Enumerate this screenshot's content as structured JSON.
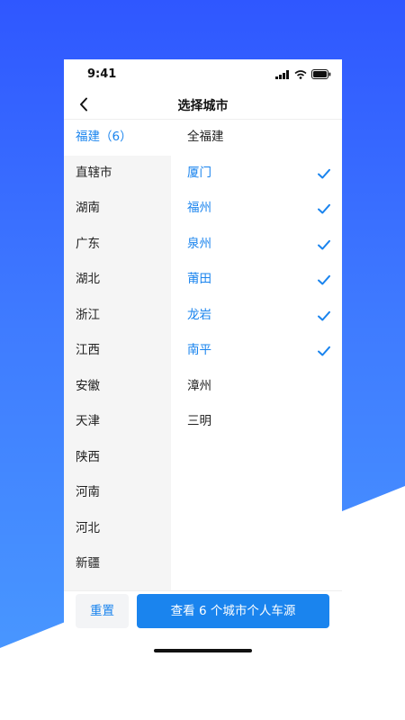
{
  "status_bar": {
    "time": "9:41"
  },
  "nav": {
    "title": "选择城市"
  },
  "provinces": [
    {
      "label": "福建（6）",
      "active": true
    },
    {
      "label": "直辖市"
    },
    {
      "label": "湖南"
    },
    {
      "label": "广东"
    },
    {
      "label": "湖北"
    },
    {
      "label": "浙江"
    },
    {
      "label": "江西"
    },
    {
      "label": "安徽"
    },
    {
      "label": "天津"
    },
    {
      "label": "陕西"
    },
    {
      "label": "河南"
    },
    {
      "label": "河北"
    },
    {
      "label": "新疆"
    }
  ],
  "cities": [
    {
      "label": "全福建",
      "selected": false
    },
    {
      "label": "厦门",
      "selected": true
    },
    {
      "label": "福州",
      "selected": true
    },
    {
      "label": "泉州",
      "selected": true
    },
    {
      "label": "莆田",
      "selected": true
    },
    {
      "label": "龙岩",
      "selected": true
    },
    {
      "label": "南平",
      "selected": true
    },
    {
      "label": "漳州",
      "selected": false
    },
    {
      "label": "三明",
      "selected": false
    }
  ],
  "bottom": {
    "reset_label": "重置",
    "view_label": "查看 6 个城市个人车源"
  },
  "colors": {
    "accent": "#1a84ee",
    "background_top": "#2f57ff",
    "background_bottom": "#4a9cff"
  }
}
